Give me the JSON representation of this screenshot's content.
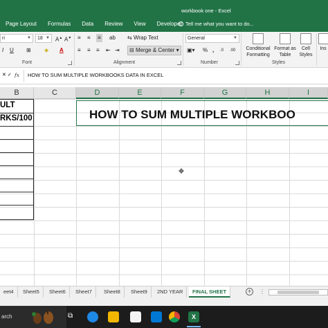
{
  "window": {
    "title": "workbook one - Excel"
  },
  "ribbon_tabs": [
    "Page Layout",
    "Formulas",
    "Data",
    "Review",
    "View",
    "Developer"
  ],
  "tell_me": "Tell me what you want to do...",
  "font": {
    "name": "ri",
    "size": "18"
  },
  "alignment": {
    "wrap_text": "Wrap Text",
    "merge_center": "Merge & Center"
  },
  "number": {
    "format": "General"
  },
  "styles": {
    "conditional": "Conditional Formatting",
    "format_table": "Format as Table",
    "cell_styles": "Cell Styles",
    "insert": "Ins"
  },
  "group_labels": {
    "font": "Font",
    "alignment": "Alignment",
    "number": "Number",
    "styles": "Styles"
  },
  "formula_bar": {
    "fx": "fx",
    "content": "HOW TO SUM MULTIPLE WORKBOOKS DATA IN EXCEL"
  },
  "columns": [
    "B",
    "C",
    "D",
    "E",
    "F",
    "G",
    "H",
    "I"
  ],
  "cells": {
    "b1": "ULT",
    "b2": "RKS/100"
  },
  "sheet_title": "HOW TO SUM MULTIPLE WORKBOO",
  "sheet_tabs": [
    "eet4",
    "Sheet5",
    "Sheet6",
    "Sheet7",
    "Sheet8",
    "Sheet9",
    "2ND YEAR",
    "FINAL SHEET"
  ],
  "active_sheet": "FINAL SHEET",
  "taskbar": {
    "search": "arch"
  },
  "colors": {
    "excel_green": "#217346"
  }
}
